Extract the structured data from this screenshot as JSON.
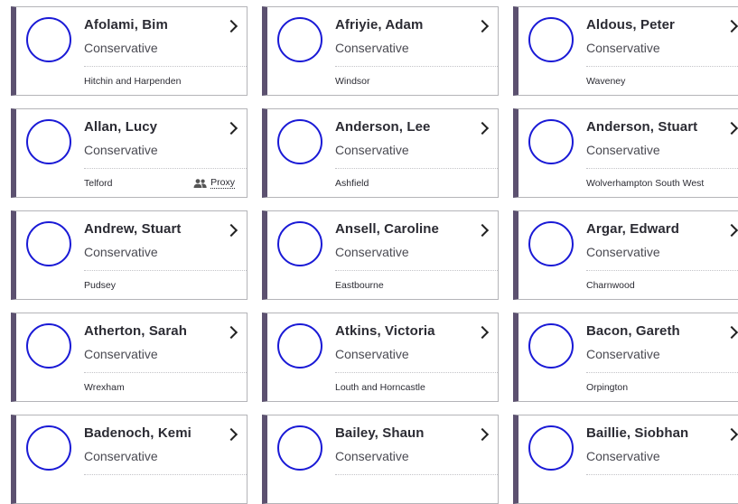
{
  "members": [
    {
      "name": "Afolami, Bim",
      "party": "Conservative",
      "constituency": "Hitchin and Harpenden"
    },
    {
      "name": "Afriyie, Adam",
      "party": "Conservative",
      "constituency": "Windsor"
    },
    {
      "name": "Aldous, Peter",
      "party": "Conservative",
      "constituency": "Waveney"
    },
    {
      "name": "Allan, Lucy",
      "party": "Conservative",
      "constituency": "Telford",
      "proxy": "Proxy"
    },
    {
      "name": "Anderson, Lee",
      "party": "Conservative",
      "constituency": "Ashfield"
    },
    {
      "name": "Anderson, Stuart",
      "party": "Conservative",
      "constituency": "Wolverhampton South West"
    },
    {
      "name": "Andrew, Stuart",
      "party": "Conservative",
      "constituency": "Pudsey"
    },
    {
      "name": "Ansell, Caroline",
      "party": "Conservative",
      "constituency": "Eastbourne"
    },
    {
      "name": "Argar, Edward",
      "party": "Conservative",
      "constituency": "Charnwood"
    },
    {
      "name": "Atherton, Sarah",
      "party": "Conservative",
      "constituency": "Wrexham"
    },
    {
      "name": "Atkins, Victoria",
      "party": "Conservative",
      "constituency": "Louth and Horncastle"
    },
    {
      "name": "Bacon, Gareth",
      "party": "Conservative",
      "constituency": "Orpington"
    },
    {
      "name": "Badenoch, Kemi",
      "party": "Conservative",
      "constituency": ""
    },
    {
      "name": "Bailey, Shaun",
      "party": "Conservative",
      "constituency": ""
    },
    {
      "name": "Baillie, Siobhan",
      "party": "Conservative",
      "constituency": ""
    }
  ],
  "icons": {
    "chevron": "chevron-right-icon",
    "proxy": "people-icon"
  },
  "colors": {
    "party_stripe": "#5c5170",
    "avatar_ring": "#1a1ad6"
  }
}
